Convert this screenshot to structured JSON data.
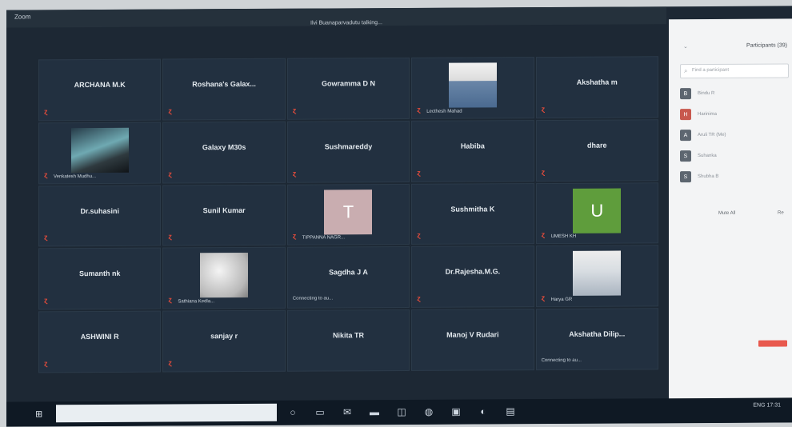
{
  "window": {
    "title": "Zoom",
    "speaking": "Ilvi Buanaparvadutu talking..."
  },
  "participants_panel": {
    "header": "Participants (39)",
    "search_placeholder": "Find a participant",
    "list": [
      {
        "name": "Bindu R",
        "avatar_color": "#5d6670",
        "initial": "B"
      },
      {
        "name": "Harinima",
        "avatar_color": "#c8584e",
        "initial": "H"
      },
      {
        "name": "Aruli TR (Me)",
        "avatar_color": "#5d6670",
        "initial": "A"
      },
      {
        "name": "Suhanka",
        "avatar_color": "#5d6670",
        "initial": "S"
      },
      {
        "name": "Shubha B",
        "avatar_color": "#5d6670",
        "initial": "S"
      }
    ],
    "mute_all_label": "Mute All",
    "more_label": "Re"
  },
  "tiles": [
    {
      "name": "ARCHANA M.K",
      "mic": "ɀ",
      "type": "name"
    },
    {
      "name": "Roshana's Galax...",
      "mic": "ɀ",
      "type": "name"
    },
    {
      "name": "Gowramma D N",
      "mic": "ɀ",
      "type": "name"
    },
    {
      "caption": "Lecthesh Mahad",
      "mic": "ɀ",
      "type": "photo",
      "style": "person"
    },
    {
      "name": "Akshatha m",
      "mic": "ɀ",
      "type": "name"
    },
    {
      "caption": "Venkatesh Mudhu...",
      "mic": "ɀ",
      "type": "photo",
      "style": "scenery"
    },
    {
      "name": "Galaxy M30s",
      "mic": "ɀ",
      "type": "name"
    },
    {
      "name": "Sushmareddy",
      "mic": "ɀ",
      "type": "name"
    },
    {
      "name": "Habiba",
      "mic": "ɀ",
      "type": "name"
    },
    {
      "name": "dhare",
      "mic": "ɀ",
      "type": "name"
    },
    {
      "name": "Dr.suhasini",
      "mic": "ɀ",
      "type": "name"
    },
    {
      "name": "Sunil Kumar",
      "mic": "ɀ",
      "type": "name"
    },
    {
      "caption": "TIPPANNA NAGR...",
      "mic": "ɀ",
      "type": "letter",
      "letter": "T",
      "color": "#c9adb0"
    },
    {
      "name": "Sushmitha K",
      "mic": "ɀ",
      "type": "name"
    },
    {
      "caption": "UMESH KH",
      "mic": "ɀ",
      "type": "letter",
      "letter": "U",
      "color": "#5f9d3c"
    },
    {
      "name": "Sumanth nk",
      "mic": "ɀ",
      "type": "name"
    },
    {
      "caption": "Sathiana Kedla...",
      "mic": "ɀ",
      "type": "photo",
      "style": "blur"
    },
    {
      "name": "Sagdha J A",
      "connecting": "Connecting to au...",
      "type": "name_conn"
    },
    {
      "name": "Dr.Rajesha.M.G.",
      "mic": "ɀ",
      "type": "name"
    },
    {
      "caption": "Harya GR",
      "mic": "ɀ",
      "type": "photo",
      "style": "suit"
    },
    {
      "name": "ASHWINI R",
      "mic": "ɀ",
      "type": "name"
    },
    {
      "name": "sanjay r",
      "mic": "ɀ",
      "type": "name"
    },
    {
      "name": "Nikita TR",
      "mic": "",
      "type": "name"
    },
    {
      "name": "Manoj V Rudari",
      "mic": "",
      "type": "name"
    },
    {
      "name": "Akshatha Dilip...",
      "connecting": "Connecting to au...",
      "type": "name_conn"
    }
  ],
  "taskbar": {
    "windows_icon": "⊞",
    "tray_text": "ENG 17:31",
    "icons": [
      "cortana-icon",
      "taskview-icon",
      "mail-icon",
      "folder-icon",
      "store-icon",
      "chrome-icon",
      "zoom-icon",
      "edge-icon",
      "app-icon"
    ]
  }
}
